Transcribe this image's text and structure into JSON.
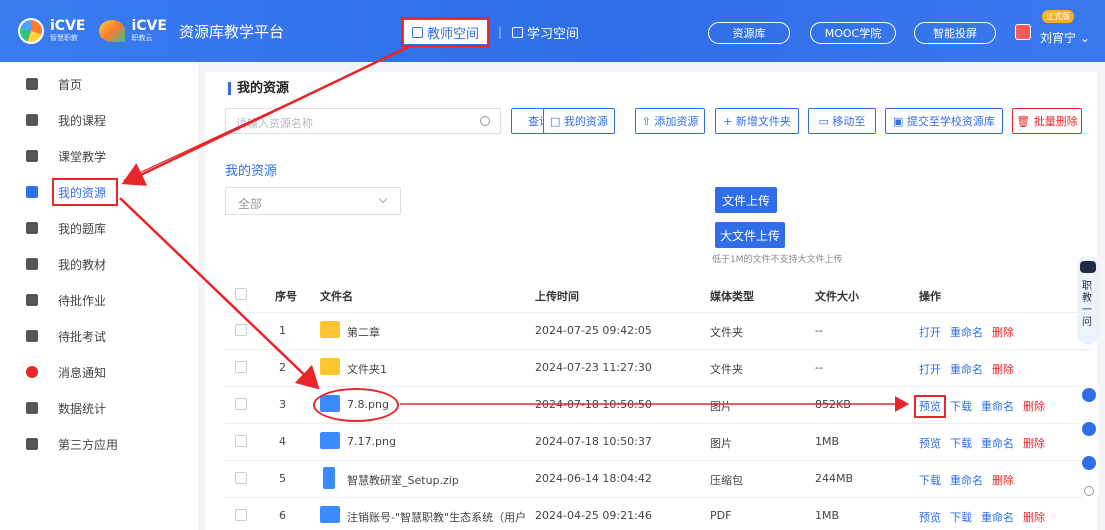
{
  "header": {
    "logo1_text": "iCVE",
    "logo1_sub": "智慧职教",
    "logo2_text": "iCVE",
    "logo2_sub": "职教云",
    "platform_title": "资源库教学平台",
    "nav_teacher": "教师空间",
    "nav_study": "学习空间",
    "nav_separator": "|",
    "pill_library": "资源库",
    "pill_mooc": "MOOC学院",
    "pill_screen": "智能投屏",
    "badge": "正式版",
    "user_name": "刘宵宁 ⌄"
  },
  "sidebar": {
    "items": [
      {
        "label": "首页",
        "icon": "home-icon"
      },
      {
        "label": "我的课程",
        "icon": "course-icon"
      },
      {
        "label": "课堂教学",
        "icon": "classroom-icon"
      },
      {
        "label": "我的资源",
        "icon": "resource-icon",
        "active": true
      },
      {
        "label": "我的题库",
        "icon": "question-bank-icon"
      },
      {
        "label": "我的教材",
        "icon": "textbook-icon"
      },
      {
        "label": "待批作业",
        "icon": "homework-icon"
      },
      {
        "label": "待批考试",
        "icon": "exam-icon"
      },
      {
        "label": "消息通知",
        "icon": "message-icon"
      },
      {
        "label": "数据统计",
        "icon": "stats-icon"
      },
      {
        "label": "第三方应用",
        "icon": "apps-icon"
      }
    ]
  },
  "main": {
    "title": "我的资源",
    "search_placeholder": "请输入资源名称",
    "buttons": {
      "query": "查询",
      "my_resources": "□ 我的资源",
      "add_resource": "⇧ 添加资源",
      "new_folder": "+ 新增文件夹",
      "move_to": "▭ 移动至",
      "submit_school": "▣ 提交至学校资源库",
      "batch_delete": "🗑 批量删除"
    },
    "subhead": "我的资源",
    "filter_value": "全部",
    "upload_file": "文件上传",
    "upload_large": "大文件上传",
    "upload_hint": "低于1M的文件不支持大文件上传"
  },
  "table": {
    "headers": {
      "index": "序号",
      "name": "文件名",
      "time": "上传时间",
      "media": "媒体类型",
      "size": "文件大小",
      "ops": "操作"
    },
    "rows": [
      {
        "index": "1",
        "name": "第二章",
        "time": "2024-07-25 09:42:05",
        "media": "文件夹",
        "size": "--",
        "icon": "folder",
        "ops": [
          "打开",
          "重命名",
          "删除"
        ]
      },
      {
        "index": "2",
        "name": "文件夹1",
        "time": "2024-07-23 11:27:30",
        "media": "文件夹",
        "size": "--",
        "icon": "folder",
        "ops": [
          "打开",
          "重命名",
          "删除"
        ]
      },
      {
        "index": "3",
        "name": "7.8.png",
        "time": "2024-07-18 10:50:50",
        "media": "图片",
        "size": "852KB",
        "icon": "image",
        "ops": [
          "预览",
          "下载",
          "重命名",
          "删除"
        ]
      },
      {
        "index": "4",
        "name": "7.17.png",
        "time": "2024-07-18 10:50:37",
        "media": "图片",
        "size": "1MB",
        "icon": "image",
        "ops": [
          "预览",
          "下载",
          "重命名",
          "删除"
        ]
      },
      {
        "index": "5",
        "name": "智慧教研室_Setup.zip",
        "time": "2024-06-14 18:04:42",
        "media": "压缩包",
        "size": "244MB",
        "icon": "zip",
        "ops": [
          "下载",
          "重命名",
          "删除"
        ]
      },
      {
        "index": "6",
        "name": "注销账号-\"智慧职教\"生态系统（用户",
        "time": "2024-04-25 09:21:46",
        "media": "PDF",
        "size": "1MB",
        "icon": "pdf",
        "ops": [
          "预览",
          "下载",
          "重命名",
          "删除"
        ]
      }
    ]
  },
  "float": {
    "assistant_label": "职教一问"
  },
  "colors": {
    "primary": "#2f6ee8",
    "danger": "#e8262a",
    "folder": "#ffc531"
  }
}
